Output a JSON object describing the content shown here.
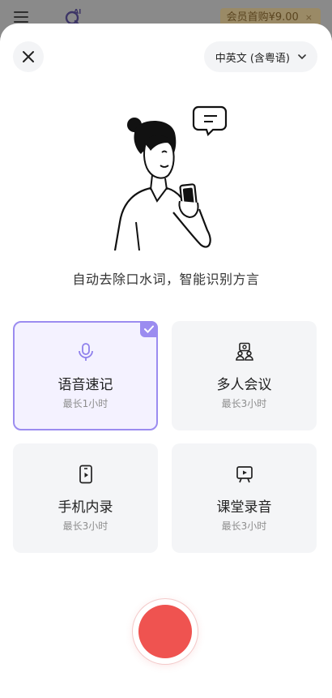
{
  "topbar": {
    "vip_label": "会员首购¥9.00",
    "vip_close": "×",
    "logo_text": "AI"
  },
  "header": {
    "language": "中英文 (含粤语)"
  },
  "tagline": "自动去除口水词，智能识别方言",
  "modes": [
    {
      "title": "语音速记",
      "subtitle": "最长1小时",
      "icon": "microphone-icon",
      "selected": true
    },
    {
      "title": "多人会议",
      "subtitle": "最长3小时",
      "icon": "people-icon",
      "selected": false
    },
    {
      "title": "手机内录",
      "subtitle": "最长3小时",
      "icon": "phone-record-icon",
      "selected": false
    },
    {
      "title": "课堂录音",
      "subtitle": "最长3小时",
      "icon": "presentation-icon",
      "selected": false
    }
  ],
  "colors": {
    "accent": "#9b8cf0",
    "record": "#ef5350"
  }
}
